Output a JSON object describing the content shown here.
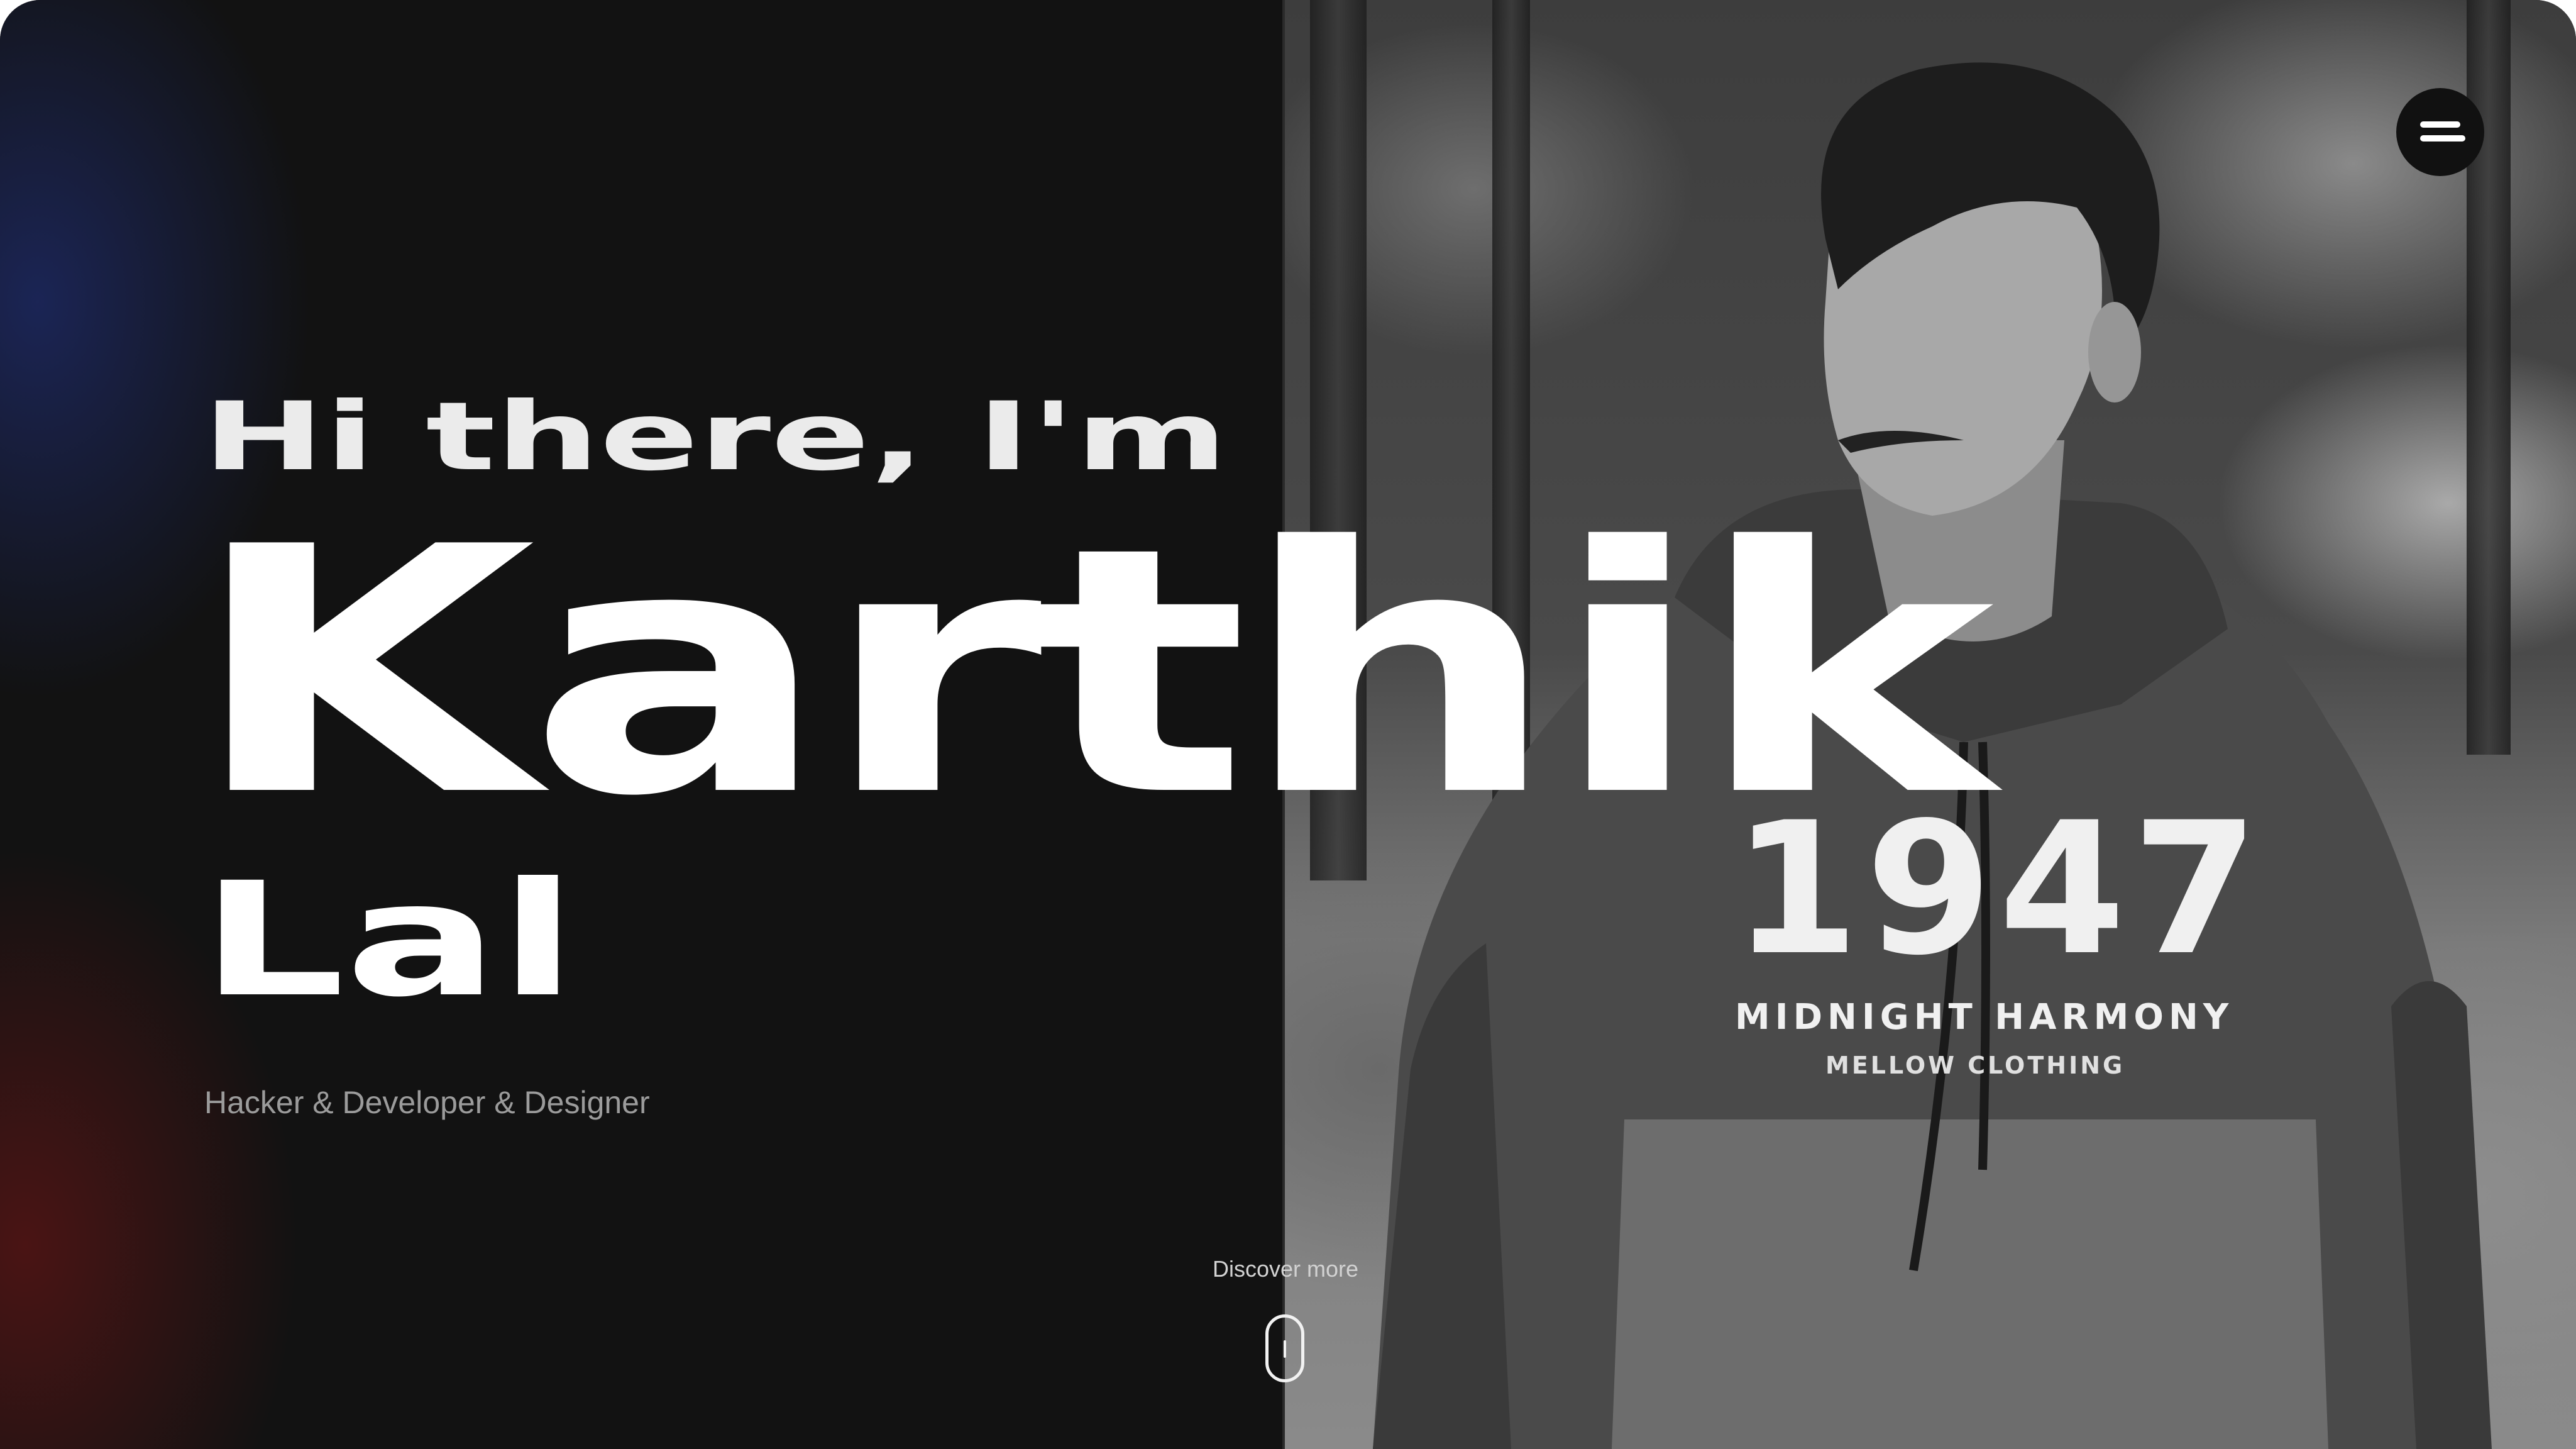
{
  "hero": {
    "greeting": "Hi there, I'm",
    "first_name": "Karthik",
    "last_name": "Lal",
    "tagline": "Hacker & Developer & Designer"
  },
  "photo": {
    "shirt_number": "1947",
    "shirt_line1": "MIDNIGHT HARMONY",
    "shirt_line2": "MELLOW CLOTHING"
  },
  "menu": {
    "icon": "menu-icon"
  },
  "scroll_cue": {
    "label": "Discover more",
    "icon": "mouse-scroll-icon"
  },
  "colors": {
    "background": "#121212",
    "text_primary": "#ffffff",
    "text_secondary": "#9b9b9b",
    "glow_blue": "#22348c",
    "glow_red": "#781616"
  }
}
